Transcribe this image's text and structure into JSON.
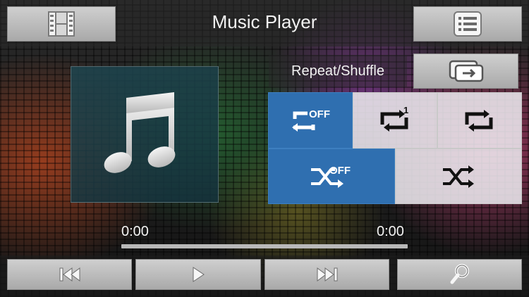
{
  "header": {
    "title": "Music Player",
    "left_icon": "film-icon",
    "right_icon": "list-icon"
  },
  "repeat_shuffle": {
    "label": "Repeat/Shuffle",
    "toggle_icon": "repeat-shuffle-toggle-icon",
    "repeat_options": [
      {
        "name": "repeat-off",
        "icon": "repeat-off-icon",
        "badge": "OFF",
        "selected": true
      },
      {
        "name": "repeat-one",
        "icon": "repeat-one-icon",
        "badge": "1",
        "selected": false
      },
      {
        "name": "repeat-all",
        "icon": "repeat-all-icon",
        "selected": false
      }
    ],
    "shuffle_options": [
      {
        "name": "shuffle-off",
        "icon": "shuffle-off-icon",
        "badge": "OFF",
        "selected": true
      },
      {
        "name": "shuffle-on",
        "icon": "shuffle-icon",
        "selected": false
      }
    ]
  },
  "player": {
    "elapsed": "0:00",
    "total": "0:00",
    "progress": 0
  },
  "controls": {
    "previous_icon": "previous-icon",
    "play_icon": "play-icon",
    "next_icon": "next-icon",
    "search_icon": "search-icon"
  },
  "colors": {
    "selected_tile": "#2f6fb0",
    "unselected_tile": "#ece8ee",
    "button": "#bdbdbd",
    "text": "#f2f2f2"
  }
}
